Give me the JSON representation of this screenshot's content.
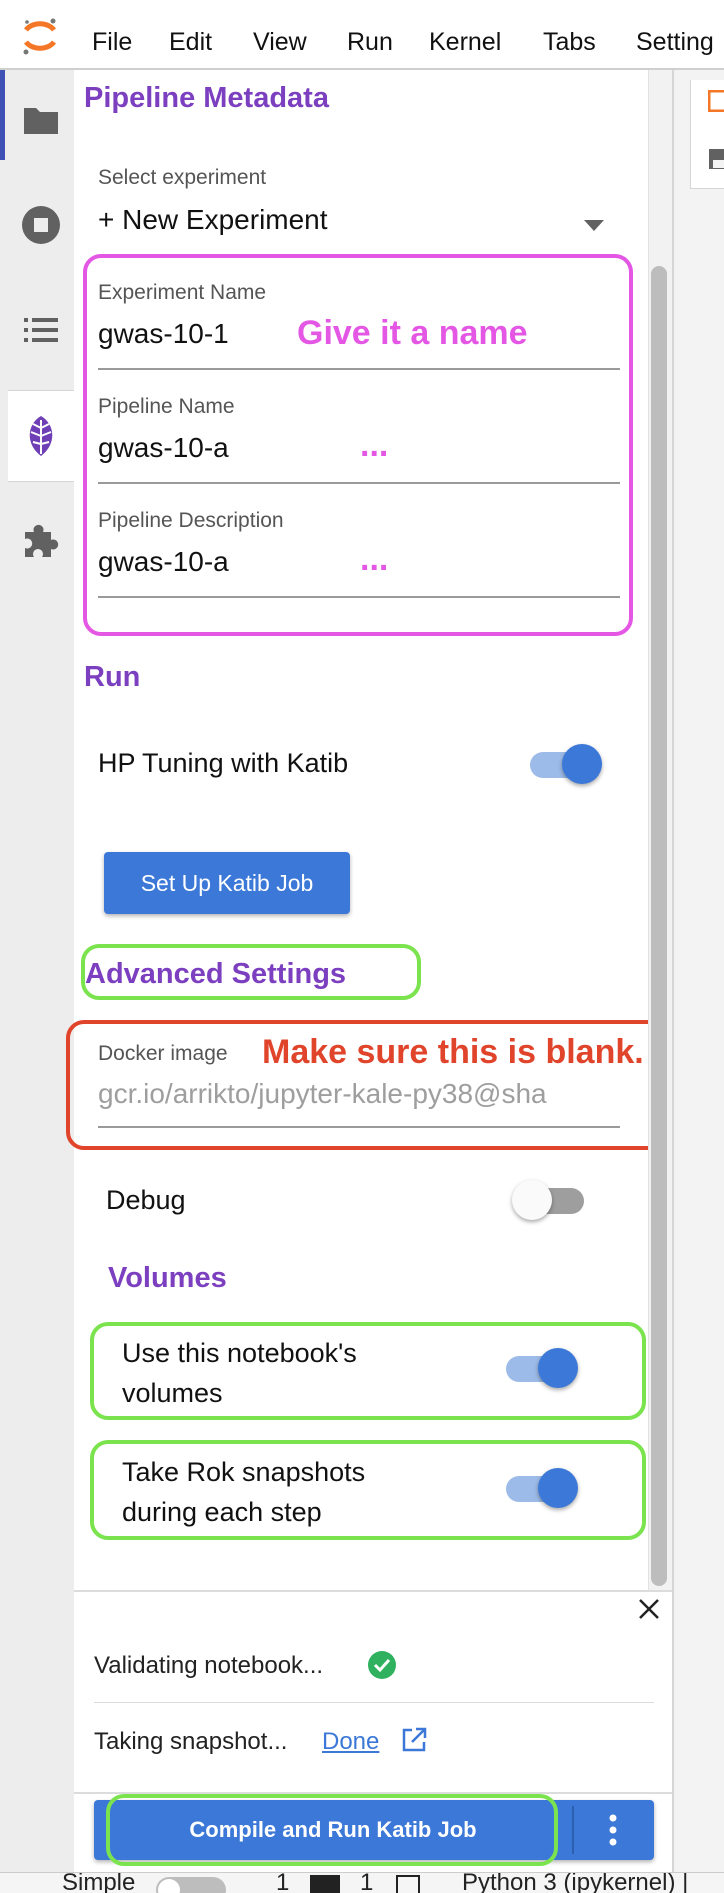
{
  "menubar": {
    "items": [
      "File",
      "Edit",
      "View",
      "Run",
      "Kernel",
      "Tabs",
      "Setting"
    ]
  },
  "sidebar": {
    "icons": [
      "folder-icon",
      "running-stop-icon",
      "table-of-contents-icon",
      "kale-icon",
      "extension-puzzle-icon"
    ],
    "active": "kale-icon"
  },
  "panel": {
    "metadata_title": "Pipeline Metadata",
    "select_experiment_label": "Select experiment",
    "select_experiment_value": "+ New Experiment",
    "experiment_name_label": "Experiment Name",
    "experiment_name_value": "gwas-10-1",
    "pipeline_name_label": "Pipeline Name",
    "pipeline_name_value": "gwas-10-a",
    "pipeline_description_label": "Pipeline Description",
    "pipeline_description_value": "gwas-10-a",
    "run_title": "Run",
    "hp_tuning_label": "HP Tuning with Katib",
    "hp_tuning_on": true,
    "setup_katib_label": "Set Up Katib Job",
    "advanced_title": "Advanced Settings",
    "docker_label": "Docker image",
    "docker_placeholder": "gcr.io/arrikto/jupyter-kale-py38@sha",
    "debug_label": "Debug",
    "debug_on": false,
    "volumes_title": "Volumes",
    "use_volumes_label_1": "Use this notebook's",
    "use_volumes_label_2": "volumes",
    "use_volumes_on": true,
    "rok_label_1": "Take Rok snapshots",
    "rok_label_2": "during each step",
    "rok_on": true
  },
  "annotations": {
    "give_name": "Give it a name",
    "ellipsis_1": "...",
    "ellipsis_2": "...",
    "make_blank": "Make sure this is blank."
  },
  "notifications": {
    "validating": "Validating notebook...",
    "snapshot": "Taking snapshot...",
    "snapshot_link": "Done"
  },
  "footer": {
    "compile_button": "Compile and Run Katib Job"
  },
  "statusbar": {
    "mode": "Simple",
    "count1": "1",
    "count2": "1",
    "kernel": "Python 3 (ipykernel) |"
  },
  "colors": {
    "accent_purple": "#7b3fbf",
    "magenta_annot": "#e457e4",
    "red_annot": "#e0442a",
    "green_annot": "#7be34d",
    "button_blue": "#3b78d8"
  }
}
